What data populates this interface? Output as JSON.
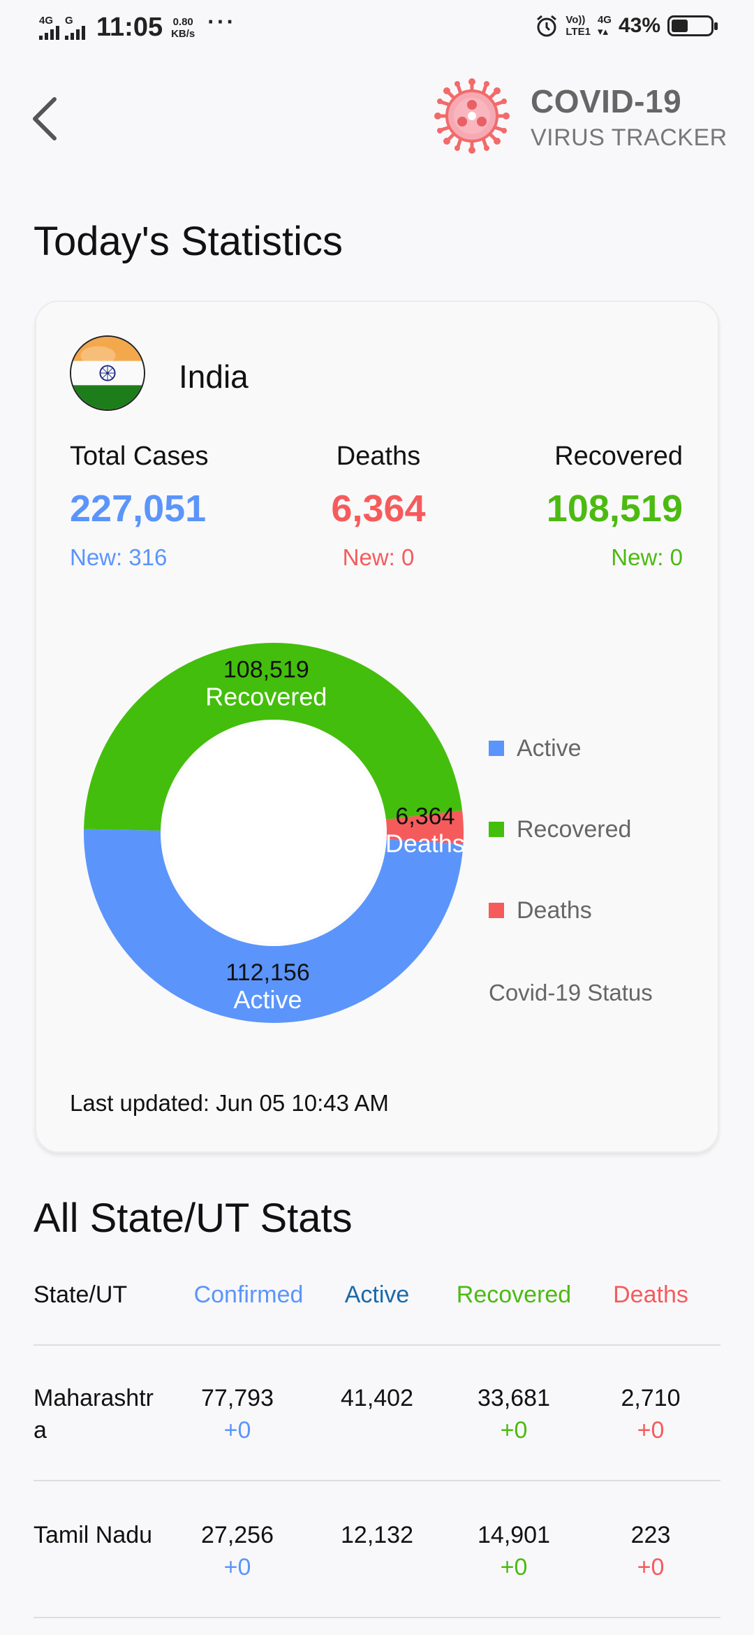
{
  "status_bar": {
    "net1": "4G",
    "net2": "G",
    "time": "11:05",
    "speed_value": "0.80",
    "speed_unit": "KB/s",
    "dots": "···",
    "volte_top": "Vo))",
    "volte_bottom": "LTE1",
    "lte": "4G",
    "battery_pct": "43%",
    "battery_level": 0.43
  },
  "header": {
    "app_title": "COVID-19",
    "app_subtitle": "VIRUS TRACKER",
    "back_icon": "chevron-left-icon",
    "logo_icon": "virus-icon"
  },
  "today": {
    "heading": "Today's Statistics",
    "country": "India",
    "total_label": "Total Cases",
    "total_value": "227,051",
    "total_new": "New: 316",
    "deaths_label": "Deaths",
    "deaths_value": "6,364",
    "deaths_new": "New: 0",
    "recovered_label": "Recovered",
    "recovered_value": "108,519",
    "recovered_new": "New: 0",
    "last_updated": "Last updated: Jun 05 10:43 AM"
  },
  "chart_data": {
    "type": "pie",
    "categories": [
      "Active",
      "Recovered",
      "Deaths"
    ],
    "values": [
      112156,
      108519,
      6364
    ],
    "value_labels": [
      "112,156",
      "108,519",
      "6,364"
    ],
    "colors": [
      "#5b95fb",
      "#44be0c",
      "#f65b5c"
    ],
    "legend": [
      "Active",
      "Recovered",
      "Deaths"
    ],
    "legend_caption": "Covid-19 Status",
    "legend_position": "right"
  },
  "colors": {
    "blue": "#5b95fb",
    "green": "#4cba12",
    "red": "#f65b5c",
    "dark_blue": "#1a6aa8"
  },
  "states": {
    "heading": "All State/UT Stats",
    "headers": [
      "State/UT",
      "Confirmed",
      "Active",
      "Recovered",
      "Deaths"
    ],
    "rows": [
      {
        "name": "Maharashtr a",
        "name_line1": "Maharashtr",
        "name_line2": "a",
        "confirmed": "77,793",
        "confirmed_new": "+0",
        "active": "41,402",
        "recovered": "33,681",
        "recovered_new": "+0",
        "deaths": "2,710",
        "deaths_new": "+0"
      },
      {
        "name": "Tamil Nadu",
        "name_line1": "Tamil Nadu",
        "name_line2": "",
        "confirmed": "27,256",
        "confirmed_new": "+0",
        "active": "12,132",
        "recovered": "14,901",
        "recovered_new": "+0",
        "deaths": "223",
        "deaths_new": "+0"
      }
    ]
  }
}
